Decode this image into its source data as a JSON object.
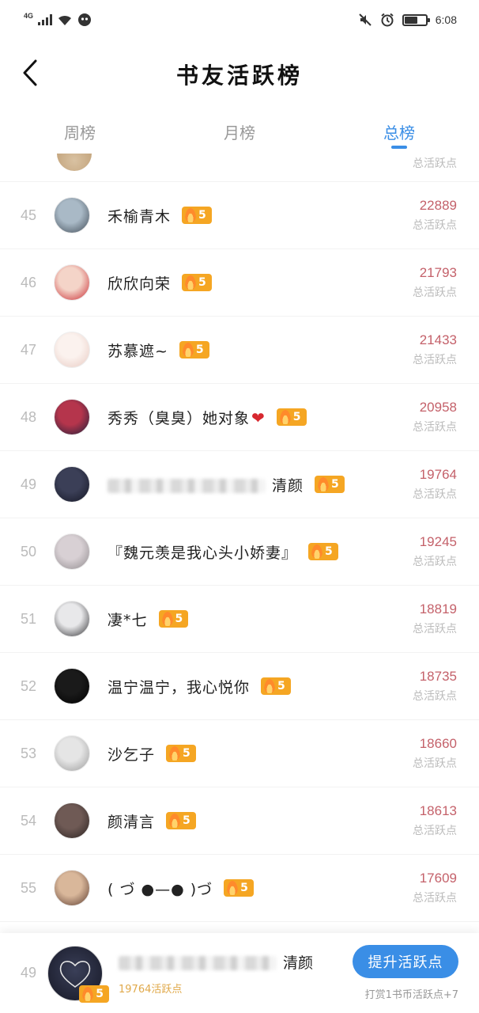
{
  "status_bar": {
    "network": "4G",
    "time": "6:08"
  },
  "header": {
    "title": "书友活跃榜"
  },
  "tabs": [
    {
      "label": "周榜",
      "active": false
    },
    {
      "label": "月榜",
      "active": false
    },
    {
      "label": "总榜",
      "active": true
    }
  ],
  "score_label": "总活跃点",
  "partial_row_label": "总活跃点",
  "rows": [
    {
      "rank": "45",
      "name": "禾榆青木",
      "level": "5",
      "score": "22889",
      "score_label": "总活跃点",
      "avatar_colors": [
        "#a9b9c6",
        "#3f4a55"
      ]
    },
    {
      "rank": "46",
      "name": "欣欣向荣",
      "level": "5",
      "score": "21793",
      "score_label": "总活跃点",
      "avatar_colors": [
        "#f4d4c8",
        "#c8262e"
      ]
    },
    {
      "rank": "47",
      "name": "苏慕遮~",
      "level": "5",
      "score": "21433",
      "score_label": "总活跃点",
      "avatar_colors": [
        "#fbf2ee",
        "#e8c9c1"
      ]
    },
    {
      "rank": "48",
      "name": "秀秀（臭臭）她对象",
      "level": "5",
      "score": "20958",
      "score_label": "总活跃点",
      "avatar_colors": [
        "#b5354c",
        "#1c1f3a"
      ],
      "heart": "❤"
    },
    {
      "rank": "49",
      "name": "清颜",
      "level": "5",
      "score": "19764",
      "score_label": "总活跃点",
      "avatar_colors": [
        "#3b3f57",
        "#141624"
      ],
      "blurred_prefix": true
    },
    {
      "rank": "50",
      "name": "『魏元羡是我心头小娇妻』",
      "level": "5",
      "score": "19245",
      "score_label": "总活跃点",
      "avatar_colors": [
        "#d8d0d4",
        "#8f8a8d"
      ]
    },
    {
      "rank": "51",
      "name": "凄*七",
      "level": "5",
      "score": "18819",
      "score_label": "总活跃点",
      "avatar_colors": [
        "#e8e8ea",
        "#2d2d30"
      ]
    },
    {
      "rank": "52",
      "name": "温宁温宁，我心悦你",
      "level": "5",
      "score": "18735",
      "score_label": "总活跃点",
      "avatar_colors": [
        "#1a1a1a",
        "#000000"
      ]
    },
    {
      "rank": "53",
      "name": "沙乞子",
      "level": "5",
      "score": "18660",
      "score_label": "总活跃点",
      "avatar_colors": [
        "#e5e5e5",
        "#9a9a9a"
      ]
    },
    {
      "rank": "54",
      "name": "颜清言",
      "level": "5",
      "score": "18613",
      "score_label": "总活跃点",
      "avatar_colors": [
        "#6f5a55",
        "#2a2220"
      ]
    },
    {
      "rank": "55",
      "name": "( づ ●—● )づ",
      "level": "5",
      "score": "17609",
      "score_label": "总活跃点",
      "avatar_colors": [
        "#d9b79a",
        "#5a3a2e"
      ]
    }
  ],
  "bottom_bar": {
    "rank": "49",
    "name": "清颜",
    "level": "5",
    "points_text": "19764活跃点",
    "boost_button": "提升活跃点",
    "hint": "打赏1书币活跃点+7"
  },
  "colors": {
    "accent": "#3a8ee6",
    "score": "#c4616a",
    "badge": "#f5a623"
  }
}
